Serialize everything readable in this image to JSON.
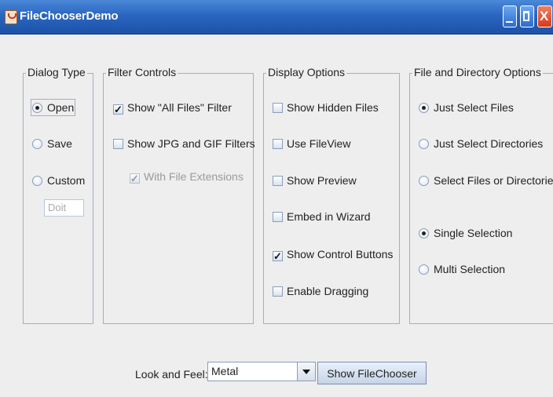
{
  "window": {
    "title": "FileChooserDemo",
    "close_glyph": "X"
  },
  "dialog_type": {
    "title": "Dialog Type",
    "options": [
      {
        "label": "Open",
        "selected": true
      },
      {
        "label": "Save",
        "selected": false
      },
      {
        "label": "Custom",
        "selected": false
      }
    ],
    "custom_field": "Doit"
  },
  "filter_controls": {
    "title": "Filter Controls",
    "items": [
      {
        "label": "Show \"All Files\" Filter",
        "checked": true,
        "enabled": true
      },
      {
        "label": "Show JPG and GIF Filters",
        "checked": false,
        "enabled": true
      },
      {
        "label": "With File Extensions",
        "checked": true,
        "enabled": false
      }
    ]
  },
  "display_options": {
    "title": "Display Options",
    "items": [
      {
        "label": "Show Hidden Files",
        "checked": false
      },
      {
        "label": "Use FileView",
        "checked": false
      },
      {
        "label": "Show Preview",
        "checked": false
      },
      {
        "label": "Embed in Wizard",
        "checked": false
      },
      {
        "label": "Show Control Buttons",
        "checked": true
      },
      {
        "label": "Enable Dragging",
        "checked": false
      }
    ]
  },
  "file_dir_options": {
    "title": "File and Directory Options",
    "mode": [
      {
        "label": "Just Select Files",
        "selected": true
      },
      {
        "label": "Just Select Directories",
        "selected": false
      },
      {
        "label": "Select Files or Directories",
        "selected": false
      }
    ],
    "selection": [
      {
        "label": "Single Selection",
        "selected": true
      },
      {
        "label": "Multi Selection",
        "selected": false
      }
    ]
  },
  "bottom": {
    "laf_label": "Look and Feel:",
    "laf_value": "Metal",
    "show_button": "Show FileChooser"
  },
  "colors": {
    "titlebar": "#2a66c0",
    "border": "#9fb0c8",
    "background": "#eeeeee"
  }
}
